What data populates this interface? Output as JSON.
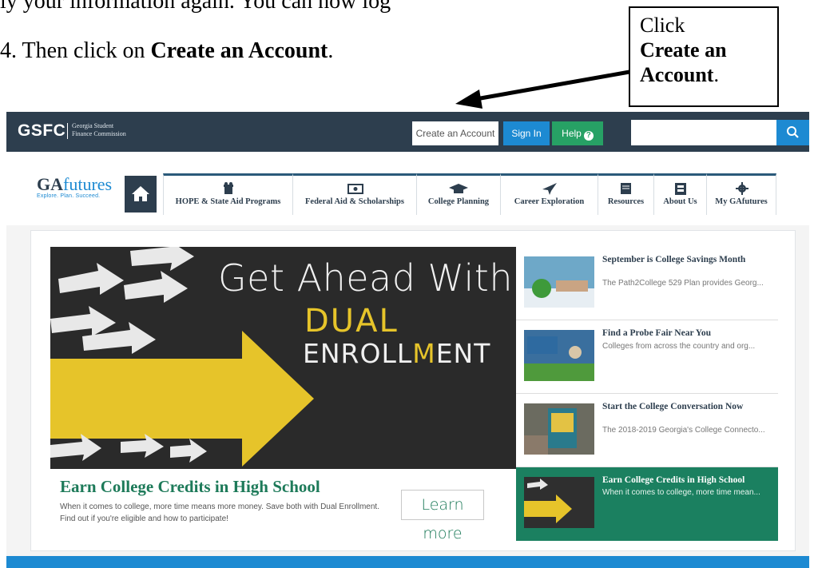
{
  "document": {
    "partial_line": "ly your information again. You can now log",
    "step_number": "4.",
    "step_prefix": "Then click on",
    "step_bold": "Create an Account",
    "step_suffix": ".",
    "callout_line1": "Click",
    "callout_bold1": "Create an",
    "callout_bold2": "Account",
    "callout_suffix": "."
  },
  "header": {
    "logo": "GSFC",
    "logo_sub1": "Georgia Student",
    "logo_sub2": "Finance Commission",
    "create_account": "Create an Account",
    "sign_in": "Sign In",
    "help": "Help",
    "help_icon": "?",
    "search_placeholder": "",
    "search_icon": "search-icon"
  },
  "brand": {
    "ga": "GA",
    "futures": "futures",
    "tagline": "Explore. Plan. Succeed."
  },
  "nav": {
    "tabs": [
      {
        "label": "HOPE & State Aid Programs",
        "icon": "gift-icon"
      },
      {
        "label": "Federal Aid & Scholarships",
        "icon": "money-icon"
      },
      {
        "label": "College Planning",
        "icon": "graduation-cap-icon"
      },
      {
        "label": "Career Exploration",
        "icon": "paper-plane-icon"
      },
      {
        "label": "Resources",
        "icon": "book-icon"
      },
      {
        "label": "About Us",
        "icon": "building-icon"
      },
      {
        "label": "My GAfutures",
        "icon": "gear-icon"
      }
    ]
  },
  "hero": {
    "title": "Get Ahead With",
    "dual": "DUAL",
    "enroll_a": "ENROLL",
    "enroll_m": "M",
    "enroll_b": "ENT",
    "caption_title": "Earn College Credits in High School",
    "caption_text": "When it comes to college, more time means more money. Save both with Dual Enrollment. Find out if you're eligible and how to participate!",
    "learn_more": "Learn more"
  },
  "news": [
    {
      "title": "September is College Savings Month",
      "text": "The Path2College 529 Plan provides Georg..."
    },
    {
      "title": "Find a Probe Fair Near You",
      "text": "Colleges from across the country and org..."
    },
    {
      "title": "Start the College Conversation Now",
      "text": "The 2018-2019 Georgia's College Connecto..."
    },
    {
      "title": "Earn College Credits in High School",
      "text": "When it comes to college, more time mean..."
    }
  ],
  "colors": {
    "topbar": "#2d3e4e",
    "signin": "#1d8ad2",
    "help": "#27a165",
    "accent_green": "#1b8060",
    "yellow": "#e6c42a"
  }
}
